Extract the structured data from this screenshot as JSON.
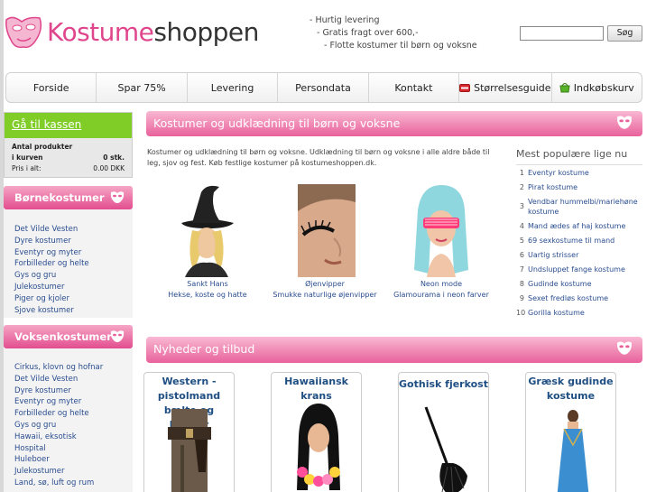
{
  "logo": {
    "part1": "Kostume",
    "part2": "shoppen"
  },
  "taglines": [
    "- Hurtig levering",
    "- Gratis fragt over 600,-",
    "- Flotte kostumer til børn og voksne"
  ],
  "search": {
    "button": "Søg",
    "value": ""
  },
  "nav": [
    {
      "label": "Forside"
    },
    {
      "label": "Spar 75%"
    },
    {
      "label": "Levering"
    },
    {
      "label": "Persondata"
    },
    {
      "label": "Kontakt"
    },
    {
      "label": "Størrelsesguide",
      "icon": "size-guide-icon"
    },
    {
      "label": "Indkøbskurv",
      "icon": "basket-icon"
    }
  ],
  "basket": {
    "title": "Gå til kassen",
    "header": "Antal produkter",
    "count_label": "i kurven",
    "count_value": "0 stk.",
    "price_label": "Pris i alt:",
    "price_value": "0.00 DKK"
  },
  "kids": {
    "title": "Børnekostumer",
    "items": [
      "Det Vilde Vesten",
      "Dyre kostumer",
      "Eventyr og myter",
      "Forbilleder og helte",
      "Gys og gru",
      "Julekostumer",
      "Piger og kjoler",
      "Sjove kostumer"
    ]
  },
  "adults": {
    "title": "Voksenkostumer",
    "items": [
      "Cirkus, klovn og hofnar",
      "Det Vilde Vesten",
      "Dyre kostumer",
      "Eventyr og myter",
      "Forbilleder og helte",
      "Gys og gru",
      "Hawaii, eksotisk",
      "Hospital",
      "Huleboer",
      "Julekostumer",
      "Land, sø, luft og rum"
    ]
  },
  "main": {
    "title": "Kostumer og udklædning til børn og voksne",
    "intro": "Kostumer og udklædning til børn og voksne. Udklædning til børn og voksne i alle aldre både til leg, sjov og fest. Køb festlige kostumer på kostumeshoppen.dk.",
    "features": [
      {
        "name": "Sankt Hans",
        "desc": "Hekse, koste og hatte"
      },
      {
        "name": "Øjenvipper",
        "desc": "Smukke naturlige øjenvipper"
      },
      {
        "name": "Neon mode",
        "desc": "Glamourama i neon farver"
      }
    ]
  },
  "popular": {
    "title": "Mest populære lige nu",
    "items": [
      "Eventyr kostume",
      "Pirat kostume",
      "Vendbar hummelbi/mariehøne kostume",
      "Mand ædes af haj kostume",
      "69 sexkostume til mand",
      "Uartig strisser",
      "Undsluppet fange kostume",
      "Gudinde kostume",
      "Sexet fredløs kostume",
      "Gorilla kostume"
    ]
  },
  "news": {
    "title": "Nyheder og tilbud",
    "cards": [
      {
        "title": "Western - pistolmand bælte og hylster"
      },
      {
        "title": "Hawaiiansk krans"
      },
      {
        "title": "Gothisk fjerkost"
      },
      {
        "title": "Græsk gudinde kostume"
      }
    ]
  }
}
